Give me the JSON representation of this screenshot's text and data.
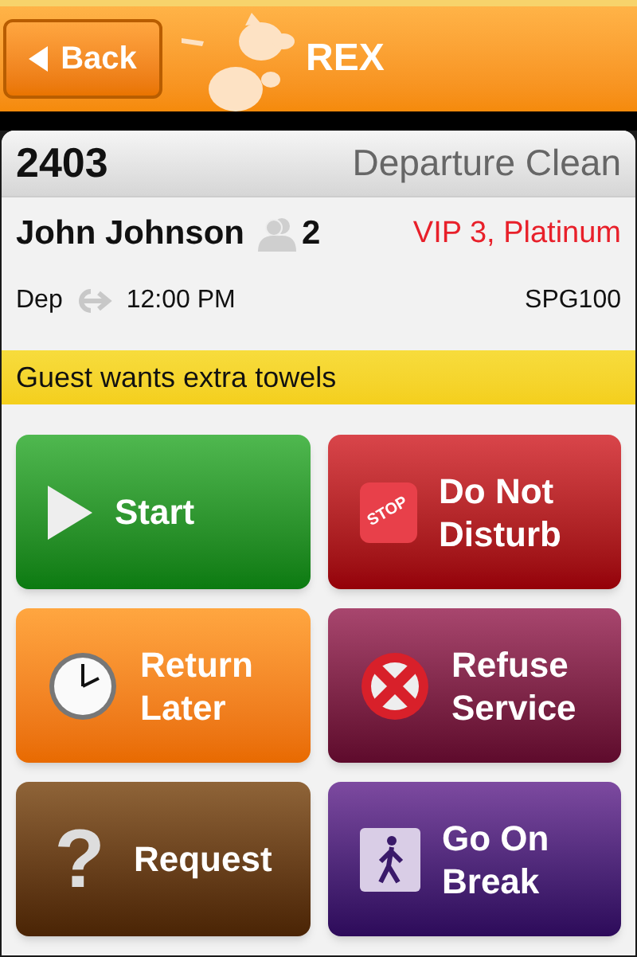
{
  "header": {
    "back": "Back",
    "title": "REX"
  },
  "room": {
    "number": "2403",
    "status": "Departure Clean"
  },
  "guest": {
    "name": "John Johnson",
    "count": "2",
    "vip": "VIP 3, Platinum"
  },
  "departure": {
    "label": "Dep",
    "time": "12:00 PM",
    "code": "SPG100"
  },
  "note": "Guest wants extra towels",
  "actions": [
    {
      "kind": "play",
      "label": [
        "Start"
      ]
    },
    {
      "kind": "stop",
      "label": [
        "Do Not",
        "Disturb"
      ],
      "icon_text": "STOP"
    },
    {
      "kind": "clock",
      "label": [
        "Return",
        "Later"
      ]
    },
    {
      "kind": "refuse",
      "label": [
        "Refuse",
        "Service"
      ]
    },
    {
      "kind": "question",
      "label": [
        "Request"
      ],
      "icon_text": "?"
    },
    {
      "kind": "walk",
      "label": [
        "Go On",
        "Break"
      ]
    }
  ]
}
